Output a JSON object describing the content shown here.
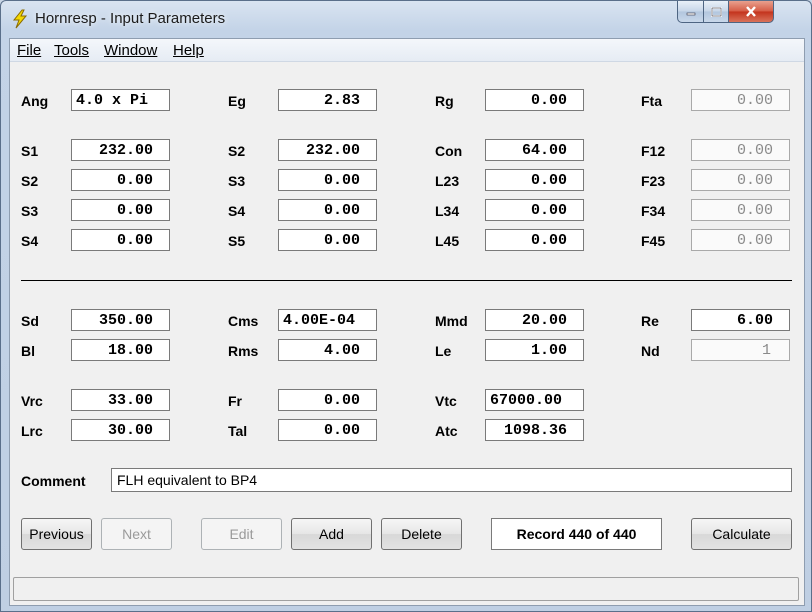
{
  "window": {
    "title": "Hornresp - Input Parameters",
    "accent": "#c3321c"
  },
  "menu": [
    "File",
    "Tools",
    "Window",
    "Help"
  ],
  "fields": {
    "ang": {
      "label": "Ang",
      "value": "4.0 x Pi"
    },
    "eg": {
      "label": "Eg",
      "value": "2.83"
    },
    "rg": {
      "label": "Rg",
      "value": "0.00"
    },
    "fta": {
      "label": "Fta",
      "value": "0.00"
    },
    "s1a": {
      "label": "S1",
      "value": "232.00"
    },
    "s2a": {
      "label": "S2",
      "value": "232.00"
    },
    "con": {
      "label": "Con",
      "value": "64.00"
    },
    "f12": {
      "label": "F12",
      "value": "0.00"
    },
    "s2b": {
      "label": "S2",
      "value": "0.00"
    },
    "s3a": {
      "label": "S3",
      "value": "0.00"
    },
    "l23": {
      "label": "L23",
      "value": "0.00"
    },
    "f23": {
      "label": "F23",
      "value": "0.00"
    },
    "s3b": {
      "label": "S3",
      "value": "0.00"
    },
    "s4a": {
      "label": "S4",
      "value": "0.00"
    },
    "l34": {
      "label": "L34",
      "value": "0.00"
    },
    "f34": {
      "label": "F34",
      "value": "0.00"
    },
    "s4b": {
      "label": "S4",
      "value": "0.00"
    },
    "s5": {
      "label": "S5",
      "value": "0.00"
    },
    "l45": {
      "label": "L45",
      "value": "0.00"
    },
    "f45": {
      "label": "F45",
      "value": "0.00"
    },
    "sd": {
      "label": "Sd",
      "value": "350.00"
    },
    "cms": {
      "label": "Cms",
      "value": "4.00E-04"
    },
    "mmd": {
      "label": "Mmd",
      "value": "20.00"
    },
    "re": {
      "label": "Re",
      "value": "6.00"
    },
    "bl": {
      "label": "Bl",
      "value": "18.00"
    },
    "rms": {
      "label": "Rms",
      "value": "4.00"
    },
    "le": {
      "label": "Le",
      "value": "1.00"
    },
    "nd": {
      "label": "Nd",
      "value": "1"
    },
    "vrc": {
      "label": "Vrc",
      "value": "33.00"
    },
    "fr": {
      "label": "Fr",
      "value": "0.00"
    },
    "vtc": {
      "label": "Vtc",
      "value": "67000.00"
    },
    "lrc": {
      "label": "Lrc",
      "value": "30.00"
    },
    "tal": {
      "label": "Tal",
      "value": "0.00"
    },
    "atc": {
      "label": "Atc",
      "value": "1098.36"
    }
  },
  "comment": {
    "label": "Comment",
    "value": "FLH equivalent to BP4"
  },
  "buttons": {
    "previous": "Previous",
    "next": "Next",
    "edit": "Edit",
    "add": "Add",
    "delete": "Delete",
    "calculate": "Calculate"
  },
  "record": "Record 440 of 440"
}
